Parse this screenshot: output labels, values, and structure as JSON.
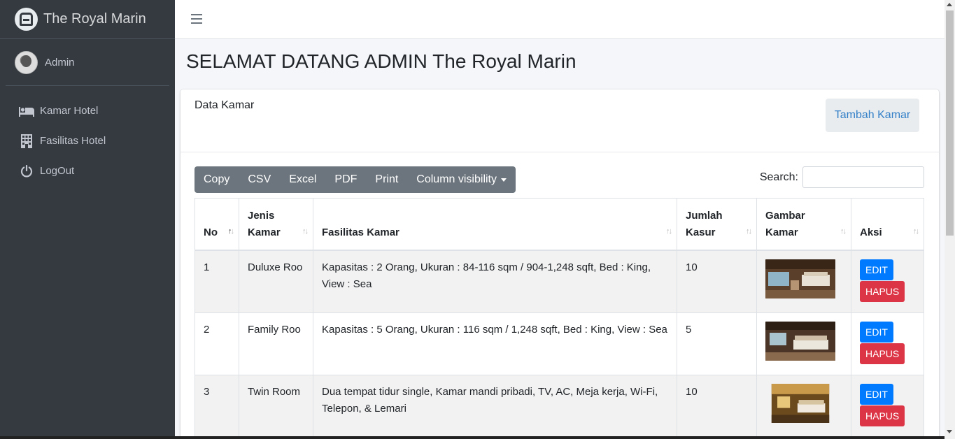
{
  "brand": {
    "name": "The Royal Marin"
  },
  "user": {
    "name": "Admin"
  },
  "sidebar": {
    "items": [
      {
        "label": "Kamar Hotel",
        "icon": "bed-icon"
      },
      {
        "label": "Fasilitas Hotel",
        "icon": "building-icon"
      },
      {
        "label": "LogOut",
        "icon": "power-icon"
      }
    ]
  },
  "page": {
    "title": "SELAMAT DATANG ADMIN The Royal Marin"
  },
  "card": {
    "title": "Data Kamar",
    "add_button": "Tambah Kamar"
  },
  "toolbar": {
    "buttons": [
      "Copy",
      "CSV",
      "Excel",
      "PDF",
      "Print",
      "Column visibility"
    ],
    "search_label": "Search:",
    "search_value": ""
  },
  "table": {
    "headers": [
      "No",
      "Jenis Kamar",
      "Fasilitas Kamar",
      "Jumlah Kasur",
      "Gambar Kamar",
      "Aksi"
    ],
    "rows": [
      {
        "no": "1",
        "jenis": "Duluxe Roo",
        "fasilitas": "Kapasitas : 2 Orang, Ukuran : 84-116 sqm / 904-1,248 sqft, Bed : King, View : Sea",
        "kasur": "10"
      },
      {
        "no": "2",
        "jenis": "Family Roo",
        "fasilitas": "Kapasitas : 5 Orang, Ukuran : 116 sqm / 1,248 sqft, Bed : King, View : Sea",
        "kasur": "5"
      },
      {
        "no": "3",
        "jenis": "Twin Room",
        "fasilitas": "Dua tempat tidur single, Kamar mandi pribadi, TV, AC, Meja kerja, Wi-Fi, Telepon, & Lemari",
        "kasur": "10"
      }
    ],
    "edit_label": "EDIT",
    "delete_label": "HAPUS"
  },
  "colors": {
    "sidebar": "#343a40",
    "primary": "#007bff",
    "danger": "#dc3545",
    "dt_buttons": "#6c757d"
  }
}
